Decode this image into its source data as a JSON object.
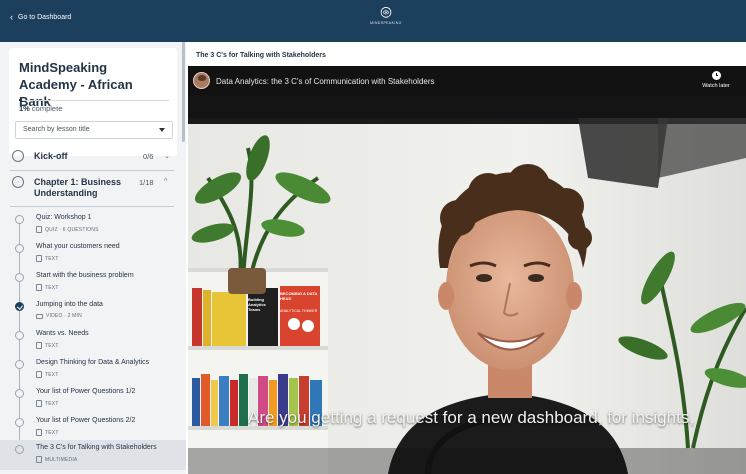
{
  "header": {
    "back_label": "Go to Dashboard",
    "logo_text": "MINDSPEAKING"
  },
  "course": {
    "title": "MindSpeaking Academy - African Bank",
    "progress_percent": "1%",
    "progress_suffix": " complete",
    "progress_value": 1
  },
  "search": {
    "placeholder": "Search by lesson title"
  },
  "sections": [
    {
      "title": "Kick-off",
      "count": "0/6",
      "expanded": false
    },
    {
      "title": "Chapter 1: Business Understanding",
      "count": "1/18",
      "expanded": true
    }
  ],
  "lessons": [
    {
      "title": "Quiz: Workshop 1",
      "meta": "QUIZ · 6 QUESTIONS",
      "done": false,
      "active": false
    },
    {
      "title": "What your customers need",
      "meta": "TEXT",
      "done": false,
      "active": false
    },
    {
      "title": "Start with the business problem",
      "meta": "TEXT",
      "done": false,
      "active": false
    },
    {
      "title": "Jumping into the data",
      "meta": "VIDEO · 2 MIN",
      "done": true,
      "active": false
    },
    {
      "title": "Wants vs. Needs",
      "meta": "TEXT",
      "done": false,
      "active": false
    },
    {
      "title": "Design Thinking for Data & Analytics",
      "meta": "TEXT",
      "done": false,
      "active": false
    },
    {
      "title": "Your list of Power Questions 1/2",
      "meta": "TEXT",
      "done": false,
      "active": false
    },
    {
      "title": "Your list of Power Questions 2/2",
      "meta": "TEXT",
      "done": false,
      "active": false
    },
    {
      "title": "The 3 C's for Talking with Stakeholders",
      "meta": "MULTIMEDIA",
      "done": false,
      "active": true
    }
  ],
  "main": {
    "lesson_title": "The 3 C's for Talking with Stakeholders",
    "video_title": "Data Analytics: the 3 C's of Communication with Stakeholders",
    "watch_later": "Watch later",
    "caption": "Are you getting a request for a new dashboard, for insights,",
    "book_titles": [
      "Building Analytics Teams",
      "BECOMING A DATA HEAD",
      "ANALYTICAL THINKER"
    ]
  },
  "colors": {
    "header_bg": "#1d3f5e",
    "sidebar_bg": "#f2f3f5",
    "active_lesson_bg": "#dfe3e8",
    "text_dark": "#253444"
  },
  "icons": [
    "chevron-left-icon",
    "logo-icon",
    "caret-down-icon",
    "chevron-down-icon",
    "chevron-up-icon",
    "checkmark-icon",
    "document-icon",
    "video-icon",
    "clock-icon"
  ]
}
